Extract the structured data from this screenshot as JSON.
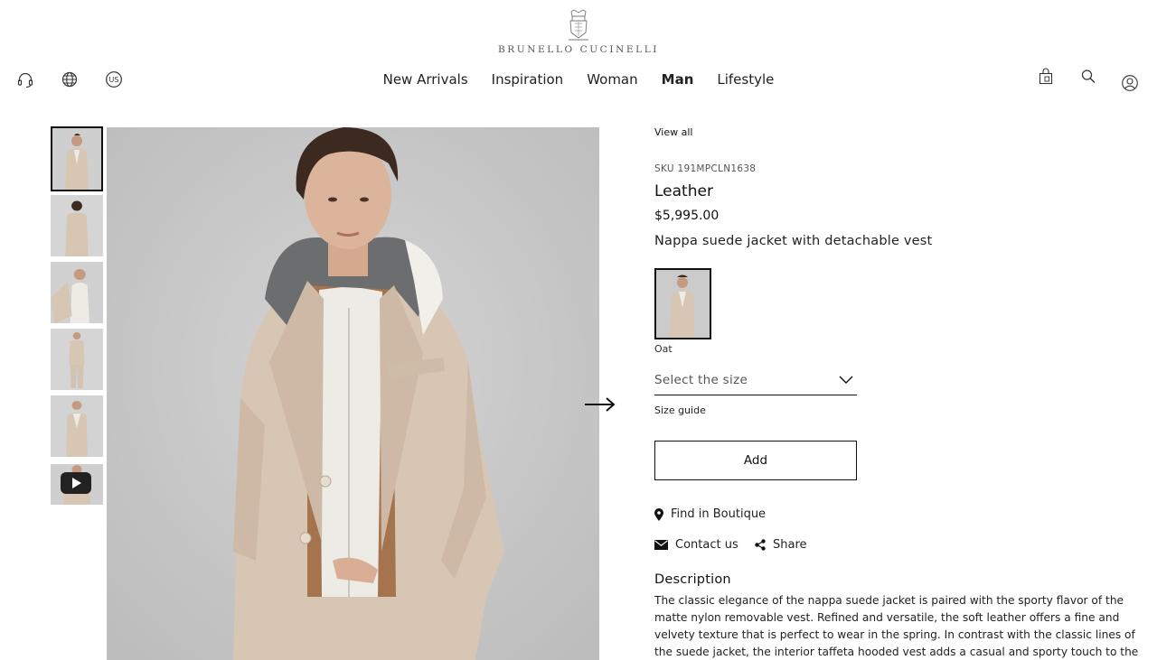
{
  "brand": {
    "name": "BRUNELLO CUCINELLI"
  },
  "nav": {
    "items": [
      {
        "label": "New Arrivals",
        "active": false
      },
      {
        "label": "Inspiration",
        "active": false
      },
      {
        "label": "Woman",
        "active": false
      },
      {
        "label": "Man",
        "active": true
      },
      {
        "label": "Lifestyle",
        "active": false
      }
    ]
  },
  "utility_left": [
    {
      "icon": "headset-icon"
    },
    {
      "icon": "globe-icon"
    },
    {
      "icon": "country-us-icon",
      "label": "US"
    }
  ],
  "utility_right": [
    {
      "icon": "shopping-bag-icon"
    },
    {
      "icon": "search-icon"
    },
    {
      "icon": "account-icon"
    }
  ],
  "gallery": {
    "thumbnails": [
      {
        "kind": "image",
        "selected": true
      },
      {
        "kind": "image",
        "selected": false
      },
      {
        "kind": "image",
        "selected": false
      },
      {
        "kind": "image",
        "selected": false
      },
      {
        "kind": "image",
        "selected": false
      },
      {
        "kind": "video",
        "selected": false
      }
    ],
    "next_icon": "arrow-right-icon"
  },
  "product": {
    "view_all": "View all",
    "sku": "SKU 191MPCLN1638",
    "title": "Leather",
    "price": "$5,995.00",
    "subtitle": "Nappa suede jacket with detachable vest",
    "color": {
      "label": "Oat"
    },
    "size": {
      "placeholder": "Select the size"
    },
    "size_guide": "Size guide",
    "add_label": "Add",
    "find_in_boutique": "Find in Boutique",
    "contact_us": "Contact us",
    "share": "Share",
    "description_title": "Description",
    "description_text": "The classic elegance of the nappa suede jacket is paired with the sporty flavor of the matte nylon removable vest. Refined and versatile, the soft leather offers a fine and velvety texture that is perfect to wear in the spring. In contrast with the classic lines of the suede jacket, the interior taffeta hooded vest adds a casual and sporty touch to the garment. To make"
  },
  "colors": {
    "text": "#111111",
    "muted": "#555555",
    "photo_background": "#c8c8c9",
    "jacket": "#d8c6b4"
  }
}
